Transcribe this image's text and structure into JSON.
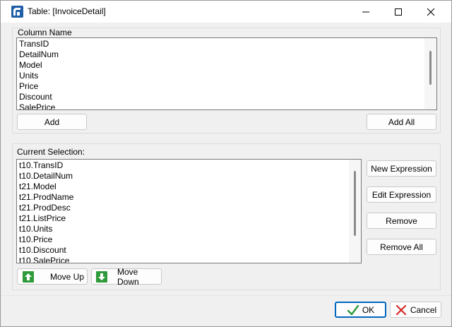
{
  "window": {
    "title": "Table: [InvoiceDetail]",
    "icon": "table-app-icon"
  },
  "column_group": {
    "label": "Column Name",
    "items": [
      "TransID",
      "DetailNum",
      "Model",
      "Units",
      "Price",
      "Discount",
      "SalePrice"
    ],
    "add_label": "Add",
    "add_all_label": "Add All"
  },
  "selection_group": {
    "label": "Current Selection:",
    "items": [
      "t10.TransID",
      "t10.DetailNum",
      "t21.Model",
      "t21.ProdName",
      "t21.ProdDesc",
      "t21.ListPrice",
      "t10.Units",
      "t10.Price",
      "t10.Discount",
      "t10.SalePrice"
    ],
    "new_expression_label": "New Expression",
    "edit_expression_label": "Edit Expression",
    "remove_label": "Remove",
    "remove_all_label": "Remove All",
    "move_up_label": "Move Up",
    "move_down_label": "Move Down"
  },
  "footer": {
    "ok_label": "OK",
    "cancel_label": "Cancel"
  },
  "colors": {
    "accent": "#0067c0",
    "arrow_green": "#2e9a3a",
    "cancel_red": "#d62b2b",
    "ok_green": "#2e9a3a"
  }
}
